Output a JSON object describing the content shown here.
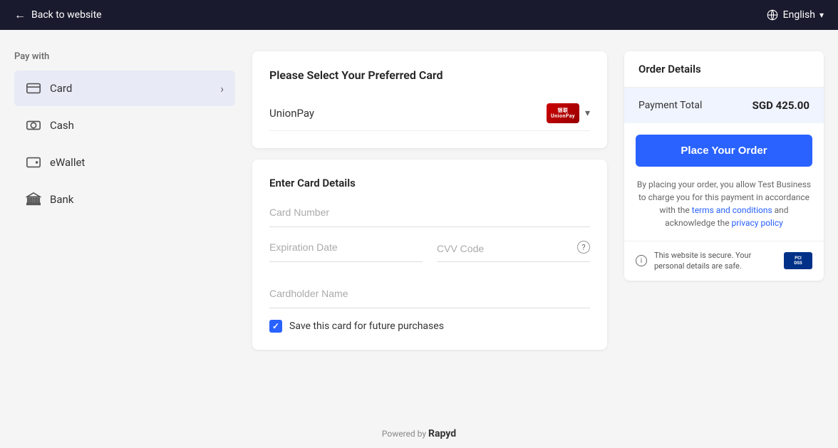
{
  "topnav": {
    "back_label": "Back to website",
    "language_label": "English"
  },
  "sidebar": {
    "pay_with_label": "Pay with",
    "methods": [
      {
        "id": "card",
        "label": "Card",
        "icon": "card-icon",
        "active": true
      },
      {
        "id": "cash",
        "label": "Cash",
        "icon": "cash-icon",
        "active": false
      },
      {
        "id": "ewallet",
        "label": "eWallet",
        "icon": "ewallet-icon",
        "active": false
      },
      {
        "id": "bank",
        "label": "Bank",
        "icon": "bank-icon",
        "active": false
      }
    ]
  },
  "card_selector": {
    "panel_title": "Please Select Your Preferred Card",
    "selected_card": "UnionPay"
  },
  "card_form": {
    "section_title": "Enter Card Details",
    "card_number_placeholder": "Card Number",
    "expiration_placeholder": "Expiration Date",
    "cvv_placeholder": "CVV Code",
    "cardholder_placeholder": "Cardholder Name",
    "save_card_label": "Save this card for future purchases"
  },
  "order": {
    "title": "Order Details",
    "payment_total_label": "Payment Total",
    "payment_total_amount": "SGD 425.00",
    "place_order_button": "Place Your Order",
    "disclaimer": "By placing your order, you allow Test Business to charge you for this payment in accordance with the",
    "terms_label": "terms and conditions",
    "disclaimer2": "and acknowledge the",
    "privacy_label": "privacy policy",
    "security_text": "This website is secure. Your personal details are safe."
  },
  "footer": {
    "powered_by": "Powered by",
    "brand": "Rapyd"
  }
}
